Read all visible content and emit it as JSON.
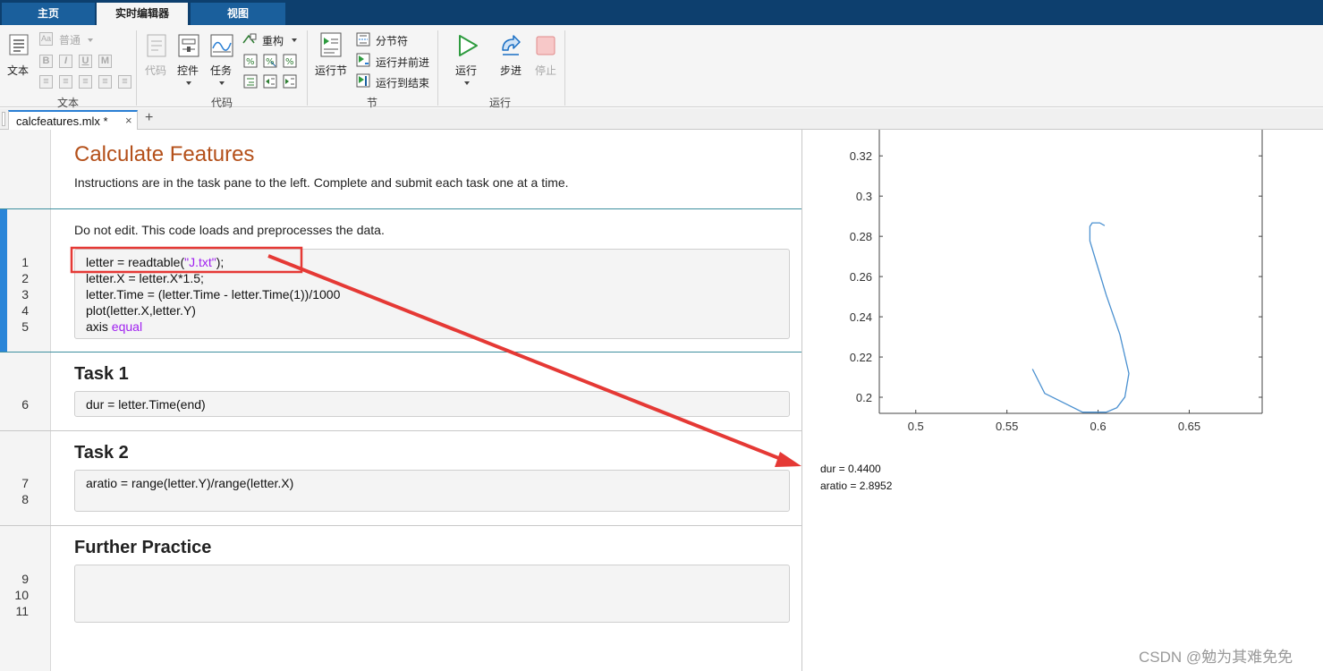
{
  "top_tabs": [
    "主页",
    "实时编辑器",
    "视图"
  ],
  "ribbon": {
    "text_group": {
      "label": "文本",
      "text_button": "文本",
      "style_select": "普通"
    },
    "code_group": {
      "label": "代码",
      "code": "代码",
      "controls": "控件",
      "task": "任务",
      "refactor": "重构"
    },
    "section_group": {
      "label": "节",
      "run_section": "运行节",
      "section_break": "分节符",
      "run_and_advance": "运行并前进",
      "run_to_end": "运行到结束"
    },
    "run_group": {
      "label": "运行",
      "run": "运行",
      "step": "步进",
      "stop": "停止"
    }
  },
  "file_tab": {
    "name": "calcfeatures.mlx *",
    "close": "×",
    "add": "+"
  },
  "editor": {
    "title": "Calculate Features",
    "instructions": "Instructions are in the task pane to the left. Complete and submit each task one at a time.",
    "section1_note": "Do not edit. This code loads and preprocesses the data.",
    "code1": {
      "line1_pre": "letter = readtable(",
      "line1_str": "\"J.txt\"",
      "line1_post": ");",
      "line2": "letter.X = letter.X*1.5;",
      "line3": "letter.Time = (letter.Time - letter.Time(1))/1000",
      "line4": "plot(letter.X,letter.Y)",
      "line5_pre": "axis ",
      "line5_kw": "equal"
    },
    "task1_heading": "Task 1",
    "code_task1": "dur = letter.Time(end)",
    "task2_heading": "Task 2",
    "code_task2": "aratio = range(letter.Y)/range(letter.X)",
    "further_heading": "Further Practice",
    "line_numbers": [
      "1",
      "2",
      "3",
      "4",
      "5",
      "6",
      "7",
      "8",
      "9",
      "10",
      "11"
    ]
  },
  "output": {
    "dur": "dur = 0.4400",
    "aratio": "aratio = 2.8952"
  },
  "chart_data": {
    "type": "line",
    "title": "",
    "xlabel": "",
    "ylabel": "",
    "xlim": [
      0.48,
      0.69
    ],
    "ylim": [
      0.192,
      0.333
    ],
    "xticks": [
      "0.5",
      "0.55",
      "0.6",
      "0.65"
    ],
    "yticks": [
      "0.2",
      "0.22",
      "0.24",
      "0.26",
      "0.28",
      "0.3",
      "0.32"
    ],
    "series": [
      {
        "color": "#4a90d0",
        "x": [
          0.6036,
          0.6009,
          0.5968,
          0.5955,
          0.5955,
          0.5995,
          0.6045,
          0.612,
          0.6169,
          0.6147,
          0.6103,
          0.6045,
          0.5915,
          0.5707,
          0.564
        ],
        "y": [
          0.2853,
          0.2867,
          0.2867,
          0.2849,
          0.2777,
          0.2656,
          0.2508,
          0.2311,
          0.2118,
          0.2001,
          0.1948,
          0.1926,
          0.1926,
          0.2019,
          0.214
        ]
      }
    ]
  },
  "annotation": {
    "color": "#e53935"
  },
  "watermark": "CSDN @勉为其难免免"
}
